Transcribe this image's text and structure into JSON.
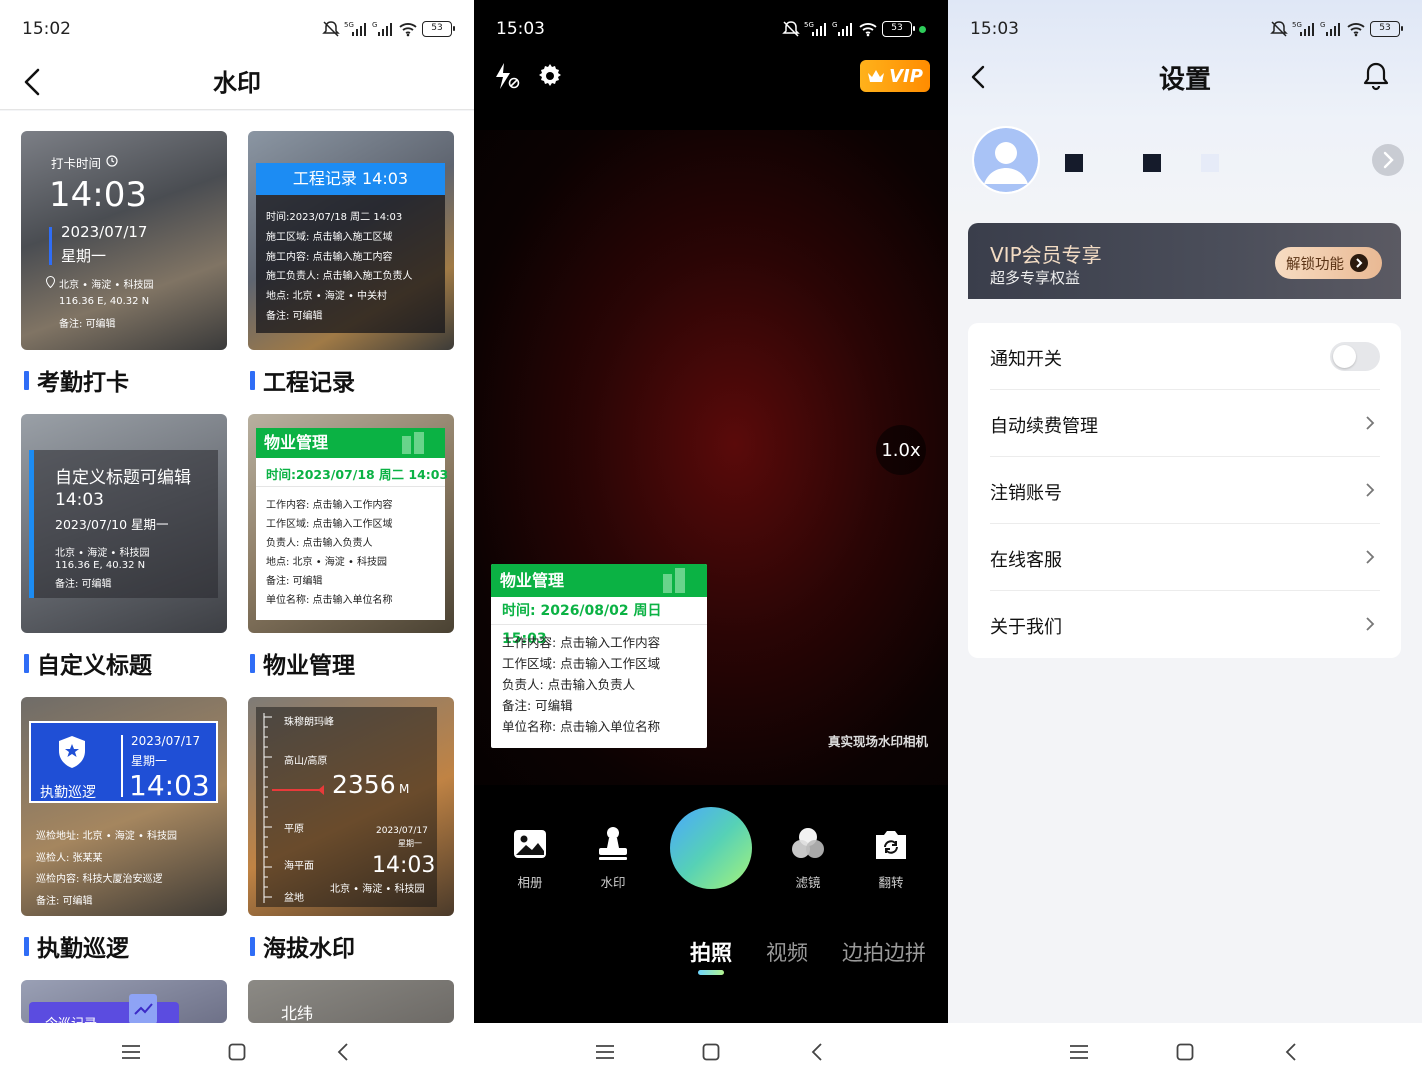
{
  "status": {
    "s1_time": "15:02",
    "s2_time": "15:03",
    "s3_time": "15:03",
    "battery": "53"
  },
  "screen1": {
    "title": "水印",
    "cards": {
      "attendance": {
        "label": "打卡时间",
        "time": "14:03",
        "date": "2023/07/17",
        "weekday": "星期一",
        "location": "北京 • 海淀 • 科技园",
        "coords": "116.36 E, 40.32 N",
        "note": "备注: 可编辑",
        "caption": "考勤打卡"
      },
      "engineering": {
        "head": "工程记录 14:03",
        "lines": [
          "时间:2023/07/18 周二 14:03",
          "施工区域:  点击输入施工区域",
          "施工内容:  点击输入施工内容",
          "施工负责人:  点击输入施工负责人",
          "地点:  北京 • 海淀 • 中关村",
          "备注: 可编辑"
        ],
        "caption": "工程记录"
      },
      "custom": {
        "head": "自定义标题可编辑",
        "time": "14:03",
        "date": "2023/07/10 星期一",
        "location": "北京 • 海淀 • 科技园",
        "coords": "116.36 E, 40.32 N",
        "note": "备注:  可编辑",
        "caption": "自定义标题"
      },
      "property": {
        "head": "物业管理",
        "time": "时间:2023/07/18 周二 14:03",
        "lines": [
          "工作内容:  点击输入工作内容",
          "工作区域:  点击输入工作区域",
          "负责人:   点击输入负责人",
          "地点:  北京 • 海淀 • 科技园",
          "备注: 可编辑",
          "单位名称:  点击输入单位名称"
        ],
        "caption": "物业管理"
      },
      "patrol": {
        "badge": "执勤巡逻",
        "date": "2023/07/17",
        "weekday": "星期一",
        "time": "14:03",
        "lines": [
          "巡检地址:  北京 • 海淀 • 科技园",
          "巡检人:  张某某",
          "巡检内容:  科技大厦治安巡逻",
          "备注:  可编辑"
        ],
        "caption": "执勤巡逻"
      },
      "altitude": {
        "levels": [
          "珠穆朗玛峰",
          "高山/高原",
          "平原",
          "海平面",
          "盆地"
        ],
        "value": "2356",
        "unit": "M",
        "date": "2023/07/17",
        "weekday": "星期一",
        "time": "14:03",
        "location": "北京 • 海淀 • 科技园",
        "caption": "海拔水印"
      },
      "partial1": {
        "head": "今巡记录"
      },
      "partial2": {
        "head": "北纬"
      }
    }
  },
  "screen2": {
    "vip": "VIP",
    "zoom": "1.0x",
    "watermark": {
      "head": "物业管理",
      "time": "时间: 2026/08/02 周日 15:03",
      "lines": [
        "工作内容: 点击输入工作内容",
        "工作区域: 点击输入工作区域",
        "负责人: 点击输入负责人",
        "备注: 可编辑",
        "单位名称: 点击输入单位名称"
      ]
    },
    "brand": "真实现场水印相机",
    "tools": {
      "album": "相册",
      "watermark": "水印",
      "filter": "滤镜",
      "flip": "翻转"
    },
    "modes": {
      "photo": "拍照",
      "video": "视频",
      "stitch": "边拍边拼"
    }
  },
  "screen3": {
    "title": "设置",
    "vip_title": "VIP会员专享",
    "vip_sub": "超多专享权益",
    "unlock": "解锁功能",
    "rows": {
      "notify": "通知开关",
      "renew": "自动续费管理",
      "delete": "注销账号",
      "service": "在线客服",
      "about": "关于我们"
    },
    "notify_on": false
  }
}
